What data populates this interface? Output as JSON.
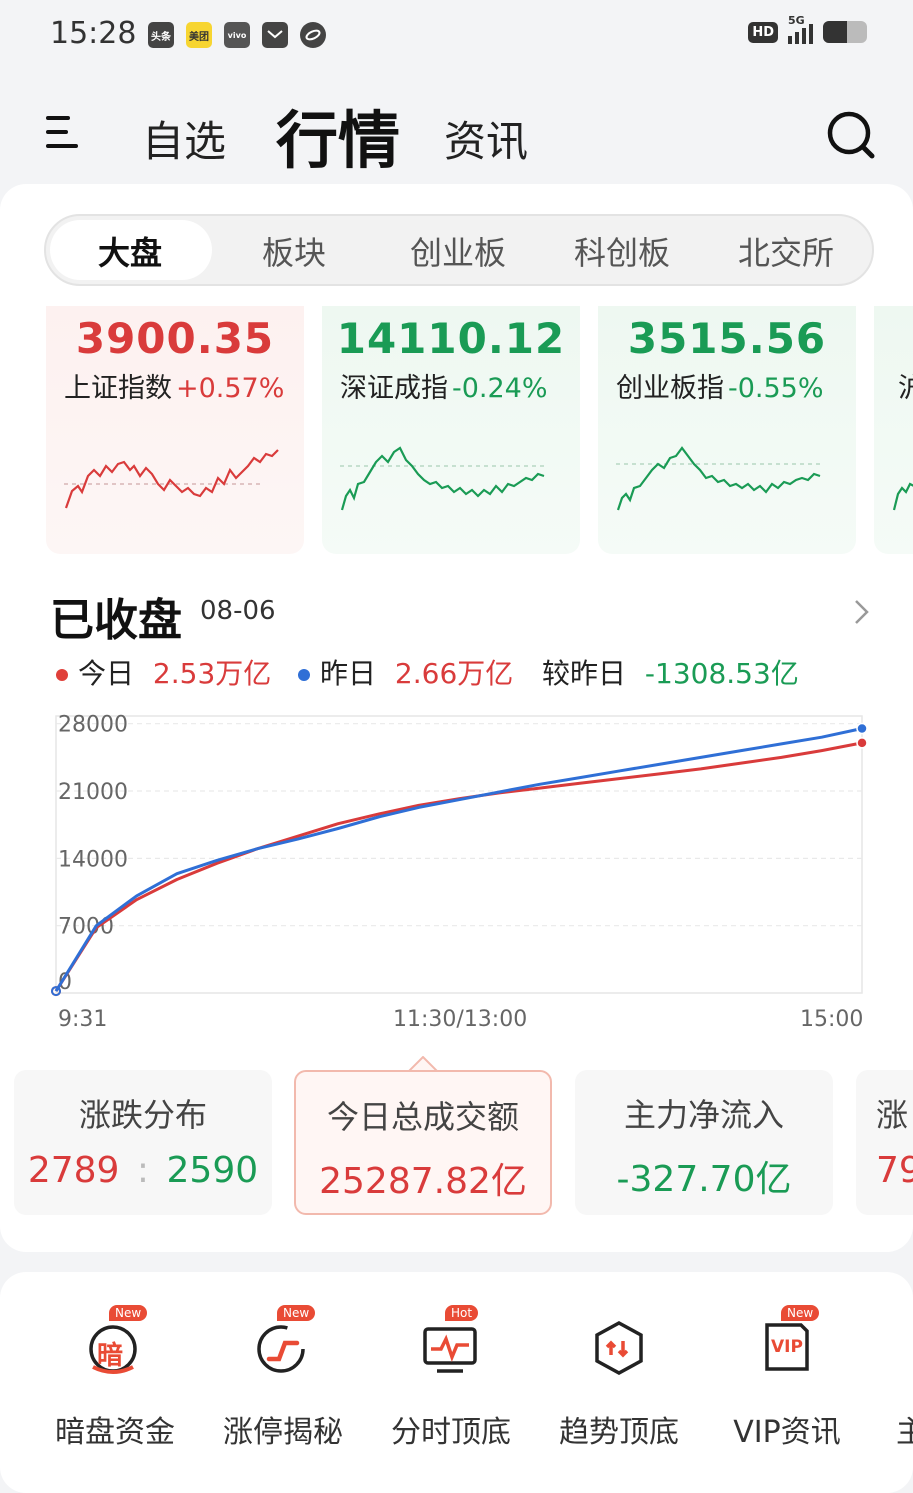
{
  "status_bar": {
    "time": "15:28",
    "apps": [
      "头条",
      "美团",
      "vivo",
      "",
      ""
    ],
    "hd": "HD",
    "network": "5G"
  },
  "header": {
    "tabs": [
      "自选",
      "行情",
      "资讯"
    ],
    "active_tab": "行情"
  },
  "segments": {
    "items": [
      "大盘",
      "板块",
      "创业板",
      "科创板",
      "北交所"
    ],
    "active": "大盘"
  },
  "indices": [
    {
      "value": "3900.35",
      "name": "上证指数",
      "change": "+0.57%",
      "trend": "up"
    },
    {
      "value": "14110.12",
      "name": "深证成指",
      "change": "-0.24%",
      "trend": "down"
    },
    {
      "value": "3515.56",
      "name": "创业板指",
      "change": "-0.55%",
      "trend": "down"
    },
    {
      "value": "",
      "name": "沪",
      "change": "",
      "trend": "down"
    }
  ],
  "turnover": {
    "title": "已收盘",
    "date": "08-06",
    "today_label": "今日",
    "today_value": "2.53万亿",
    "yesterday_label": "昨日",
    "yesterday_value": "2.66万亿",
    "compare_label": "较昨日",
    "compare_value": "-1308.53亿"
  },
  "chart_data": {
    "type": "line",
    "title": "",
    "xlabel": "",
    "ylabel": "",
    "x_ticks": [
      "9:31",
      "11:30/13:00",
      "15:00"
    ],
    "y_ticks": [
      0,
      7000,
      14000,
      21000,
      28000
    ],
    "ylim": [
      0,
      28800
    ],
    "grid": true,
    "x": [
      0,
      0.05,
      0.1,
      0.15,
      0.2,
      0.25,
      0.3,
      0.35,
      0.4,
      0.45,
      0.5,
      0.55,
      0.6,
      0.65,
      0.7,
      0.75,
      0.8,
      0.85,
      0.9,
      0.95,
      1.0
    ],
    "series": [
      {
        "name": "今日",
        "color": "#d93b3b",
        "values": [
          200,
          6800,
          9700,
          11800,
          13500,
          15000,
          16300,
          17600,
          18600,
          19500,
          20200,
          20800,
          21300,
          21800,
          22300,
          22800,
          23300,
          23900,
          24500,
          25200,
          26000
        ]
      },
      {
        "name": "昨日",
        "color": "#2f6fd6",
        "values": [
          200,
          7000,
          10100,
          12400,
          13800,
          15000,
          16000,
          17100,
          18300,
          19300,
          20100,
          20900,
          21700,
          22400,
          23100,
          23800,
          24500,
          25200,
          25900,
          26600,
          27500
        ]
      }
    ]
  },
  "stats": [
    {
      "label": "涨跌分布",
      "up": "2789",
      "sep": ":",
      "down": "2590"
    },
    {
      "label": "今日总成交额",
      "value": "25287.82亿"
    },
    {
      "label": "主力净流入",
      "value": "-327.70亿"
    },
    {
      "label": "涨",
      "value": "79"
    }
  ],
  "tools": [
    {
      "label": "暗盘资金",
      "badge": "New",
      "glyph": "暗",
      "icon": "dark-pool-icon"
    },
    {
      "label": "涨停揭秘",
      "badge": "New",
      "glyph": "",
      "icon": "limit-up-icon"
    },
    {
      "label": "分时顶底",
      "badge": "Hot",
      "glyph": "",
      "icon": "intraday-icon"
    },
    {
      "label": "趋势顶底",
      "badge": "",
      "glyph": "",
      "icon": "trend-icon"
    },
    {
      "label": "VIP资讯",
      "badge": "New",
      "glyph": "VIP",
      "icon": "vip-icon"
    },
    {
      "label": "主",
      "badge": "",
      "glyph": "",
      "icon": "more-icon"
    }
  ],
  "colors": {
    "up": "#d93b3b",
    "down": "#1a9b55",
    "today": "#d93b3b",
    "yesterday": "#2f6fd6"
  }
}
